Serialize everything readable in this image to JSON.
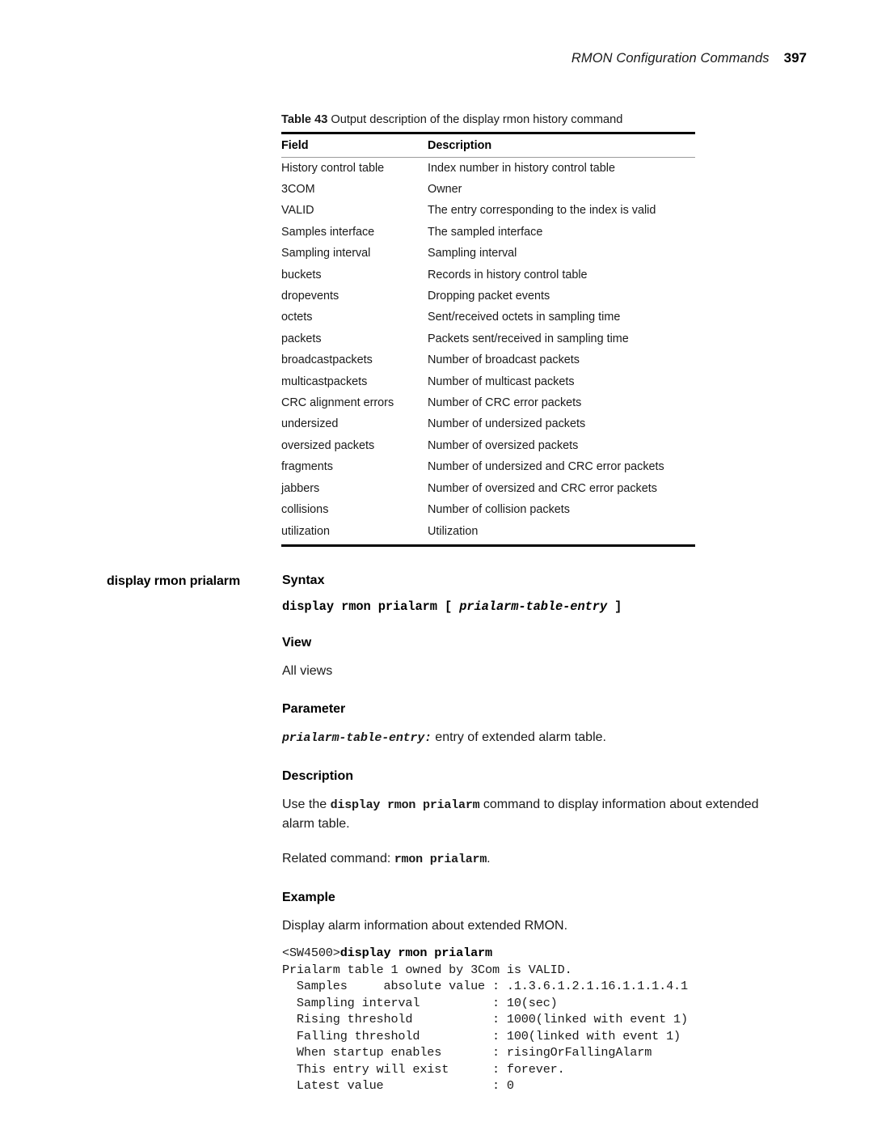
{
  "header": {
    "title": "RMON Configuration Commands",
    "page_number": "397"
  },
  "table": {
    "caption_label": "Table 43",
    "caption_text": "Output description of the display rmon history command",
    "columns": [
      "Field",
      "Description"
    ],
    "rows": [
      [
        "History control table",
        "Index number in history control table"
      ],
      [
        "3COM",
        "Owner"
      ],
      [
        "VALID",
        "The entry corresponding to the index is valid"
      ],
      [
        "Samples interface",
        "The sampled interface"
      ],
      [
        "Sampling interval",
        "Sampling interval"
      ],
      [
        "buckets",
        "Records in history control table"
      ],
      [
        "dropevents",
        "Dropping packet events"
      ],
      [
        "octets",
        "Sent/received octets in sampling time"
      ],
      [
        "packets",
        "Packets sent/received in sampling time"
      ],
      [
        "broadcastpackets",
        "Number of broadcast packets"
      ],
      [
        "multicastpackets",
        "Number of multicast packets"
      ],
      [
        "CRC alignment errors",
        "Number of CRC error packets"
      ],
      [
        "undersized",
        "Number of undersized packets"
      ],
      [
        "oversized packets",
        "Number of oversized packets"
      ],
      [
        "fragments",
        "Number of undersized and CRC error packets"
      ],
      [
        "jabbers",
        "Number of oversized and CRC error packets"
      ],
      [
        "collisions",
        "Number of collision packets"
      ],
      [
        "utilization",
        "Utilization"
      ]
    ]
  },
  "command": {
    "marginal_heading": "display rmon prialarm",
    "syntax": {
      "heading": "Syntax",
      "command_text": "display rmon prialarm [ ",
      "parameter_text": "prialarm-table-entry",
      "closing_text": " ]"
    },
    "view": {
      "heading": "View",
      "text": "All views"
    },
    "parameter": {
      "heading": "Parameter",
      "name": "prialarm-table-entry:",
      "description": " entry of extended alarm table."
    },
    "description": {
      "heading": "Description",
      "lead": "Use the ",
      "command": "display rmon prialarm",
      "trail": " command to display information about extended alarm table.",
      "related_label": "Related command: ",
      "related_command": "rmon prialarm",
      "related_period": "."
    },
    "example": {
      "heading": "Example",
      "intro": "Display alarm information about extended RMON.",
      "prompt": "<SW4500>",
      "typed_command": "display rmon prialarm",
      "output_lines": [
        "Prialarm table 1 owned by 3Com is VALID.",
        "  Samples     absolute value : .1.3.6.1.2.1.16.1.1.1.4.1",
        "  Sampling interval          : 10(sec)",
        "  Rising threshold           : 1000(linked with event 1)",
        "  Falling threshold          : 100(linked with event 1)",
        "  When startup enables       : risingOrFallingAlarm",
        "  This entry will exist      : forever.",
        "  Latest value               : 0"
      ]
    }
  }
}
